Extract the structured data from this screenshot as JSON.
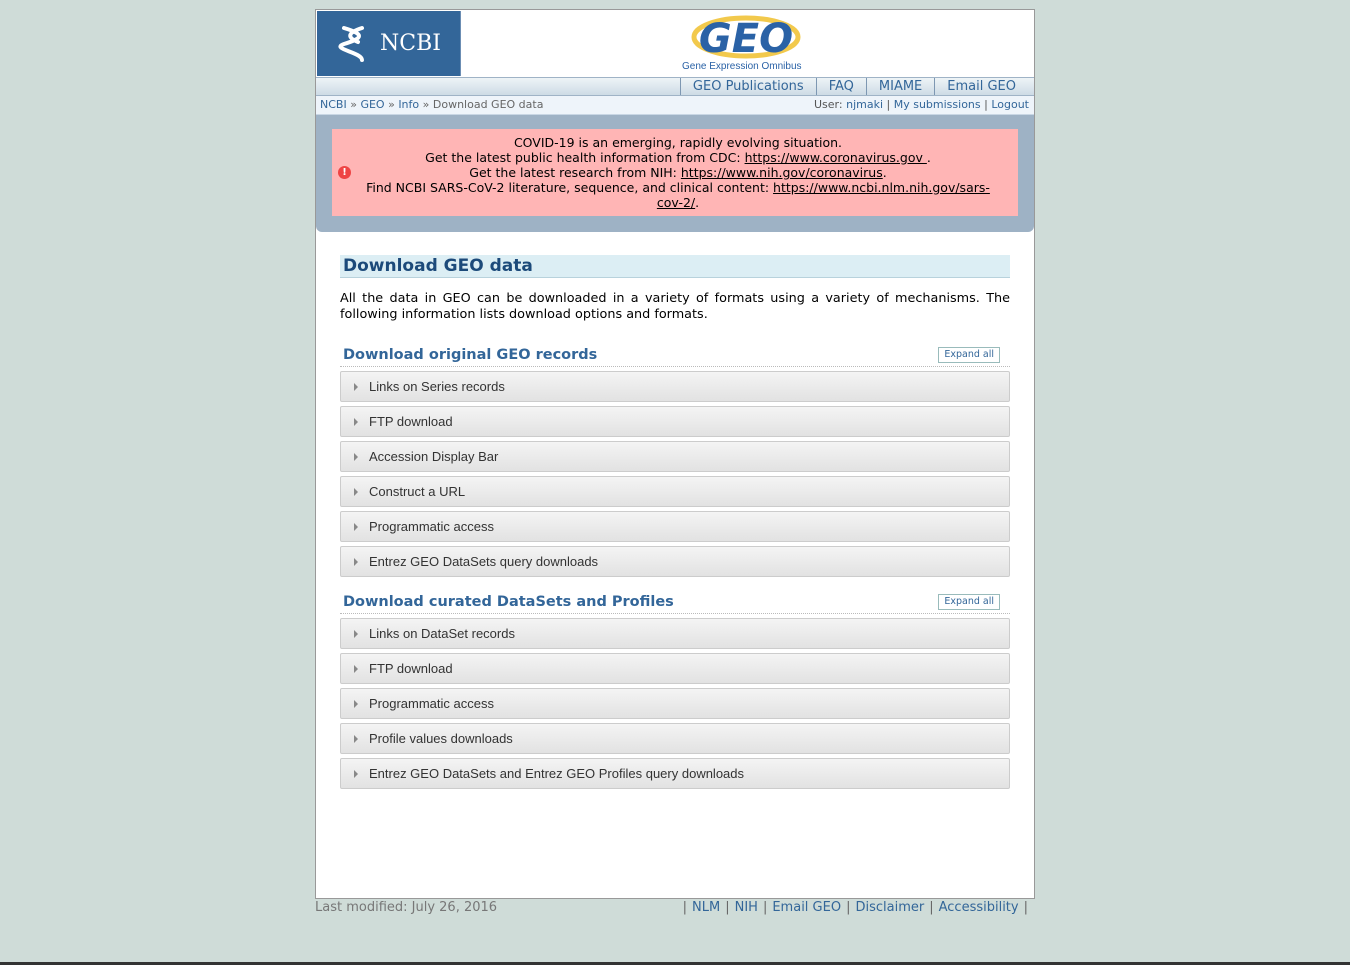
{
  "header": {
    "ncbi_logo_text": "NCBI",
    "geo_logo_text": "GEO",
    "geo_subtitle": "Gene Expression Omnibus"
  },
  "topnav": {
    "items": [
      "GEO Publications",
      "FAQ",
      "MIAME",
      "Email GEO"
    ]
  },
  "breadcrumb": {
    "items": [
      "NCBI",
      "GEO",
      "Info"
    ],
    "current": "Download GEO data",
    "separator": "»"
  },
  "user": {
    "label": "User:",
    "name": "njmaki",
    "submissions": "My submissions",
    "logout": "Logout"
  },
  "alert": {
    "line1": "COVID-19 is an emerging, rapidly evolving situation.",
    "line2_prefix": "Get the latest public health information from CDC: ",
    "line2_link": "https://www.coronavirus.gov ",
    "line3_prefix": "Get the latest research from NIH: ",
    "line3_link": "https://www.nih.gov/coronavirus",
    "line4_prefix": "Find NCBI SARS-CoV-2 literature, sequence, and clinical content: ",
    "line4_link": "https://www.ncbi.nlm.nih.gov/sars-cov-2/",
    "period": "."
  },
  "main": {
    "title": "Download GEO data",
    "intro": "All the data in GEO can be downloaded in a variety of formats using a variety of mechanisms. The following information lists download options and formats.",
    "sections": [
      {
        "heading": "Download original GEO records",
        "expand_label": "Expand all",
        "items": [
          "Links on Series records",
          "FTP download",
          "Accession Display Bar",
          "Construct a URL",
          "Programmatic access",
          "Entrez GEO DataSets query downloads"
        ]
      },
      {
        "heading": "Download curated DataSets and Profiles",
        "expand_label": "Expand all",
        "items": [
          "Links on DataSet records",
          "FTP download",
          "Programmatic access",
          "Profile values downloads",
          "Entrez GEO DataSets and Entrez GEO Profiles query downloads"
        ]
      }
    ]
  },
  "footer": {
    "last_modified": "Last modified: July 26, 2016",
    "links": [
      "NLM",
      "NIH",
      "Email GEO",
      "Disclaimer",
      "Accessibility"
    ]
  },
  "colors": {
    "link": "#336699",
    "alert_bg": "#ffb5b5",
    "ncbi_blue": "#336699",
    "page_bg": "#cfdcd8"
  }
}
